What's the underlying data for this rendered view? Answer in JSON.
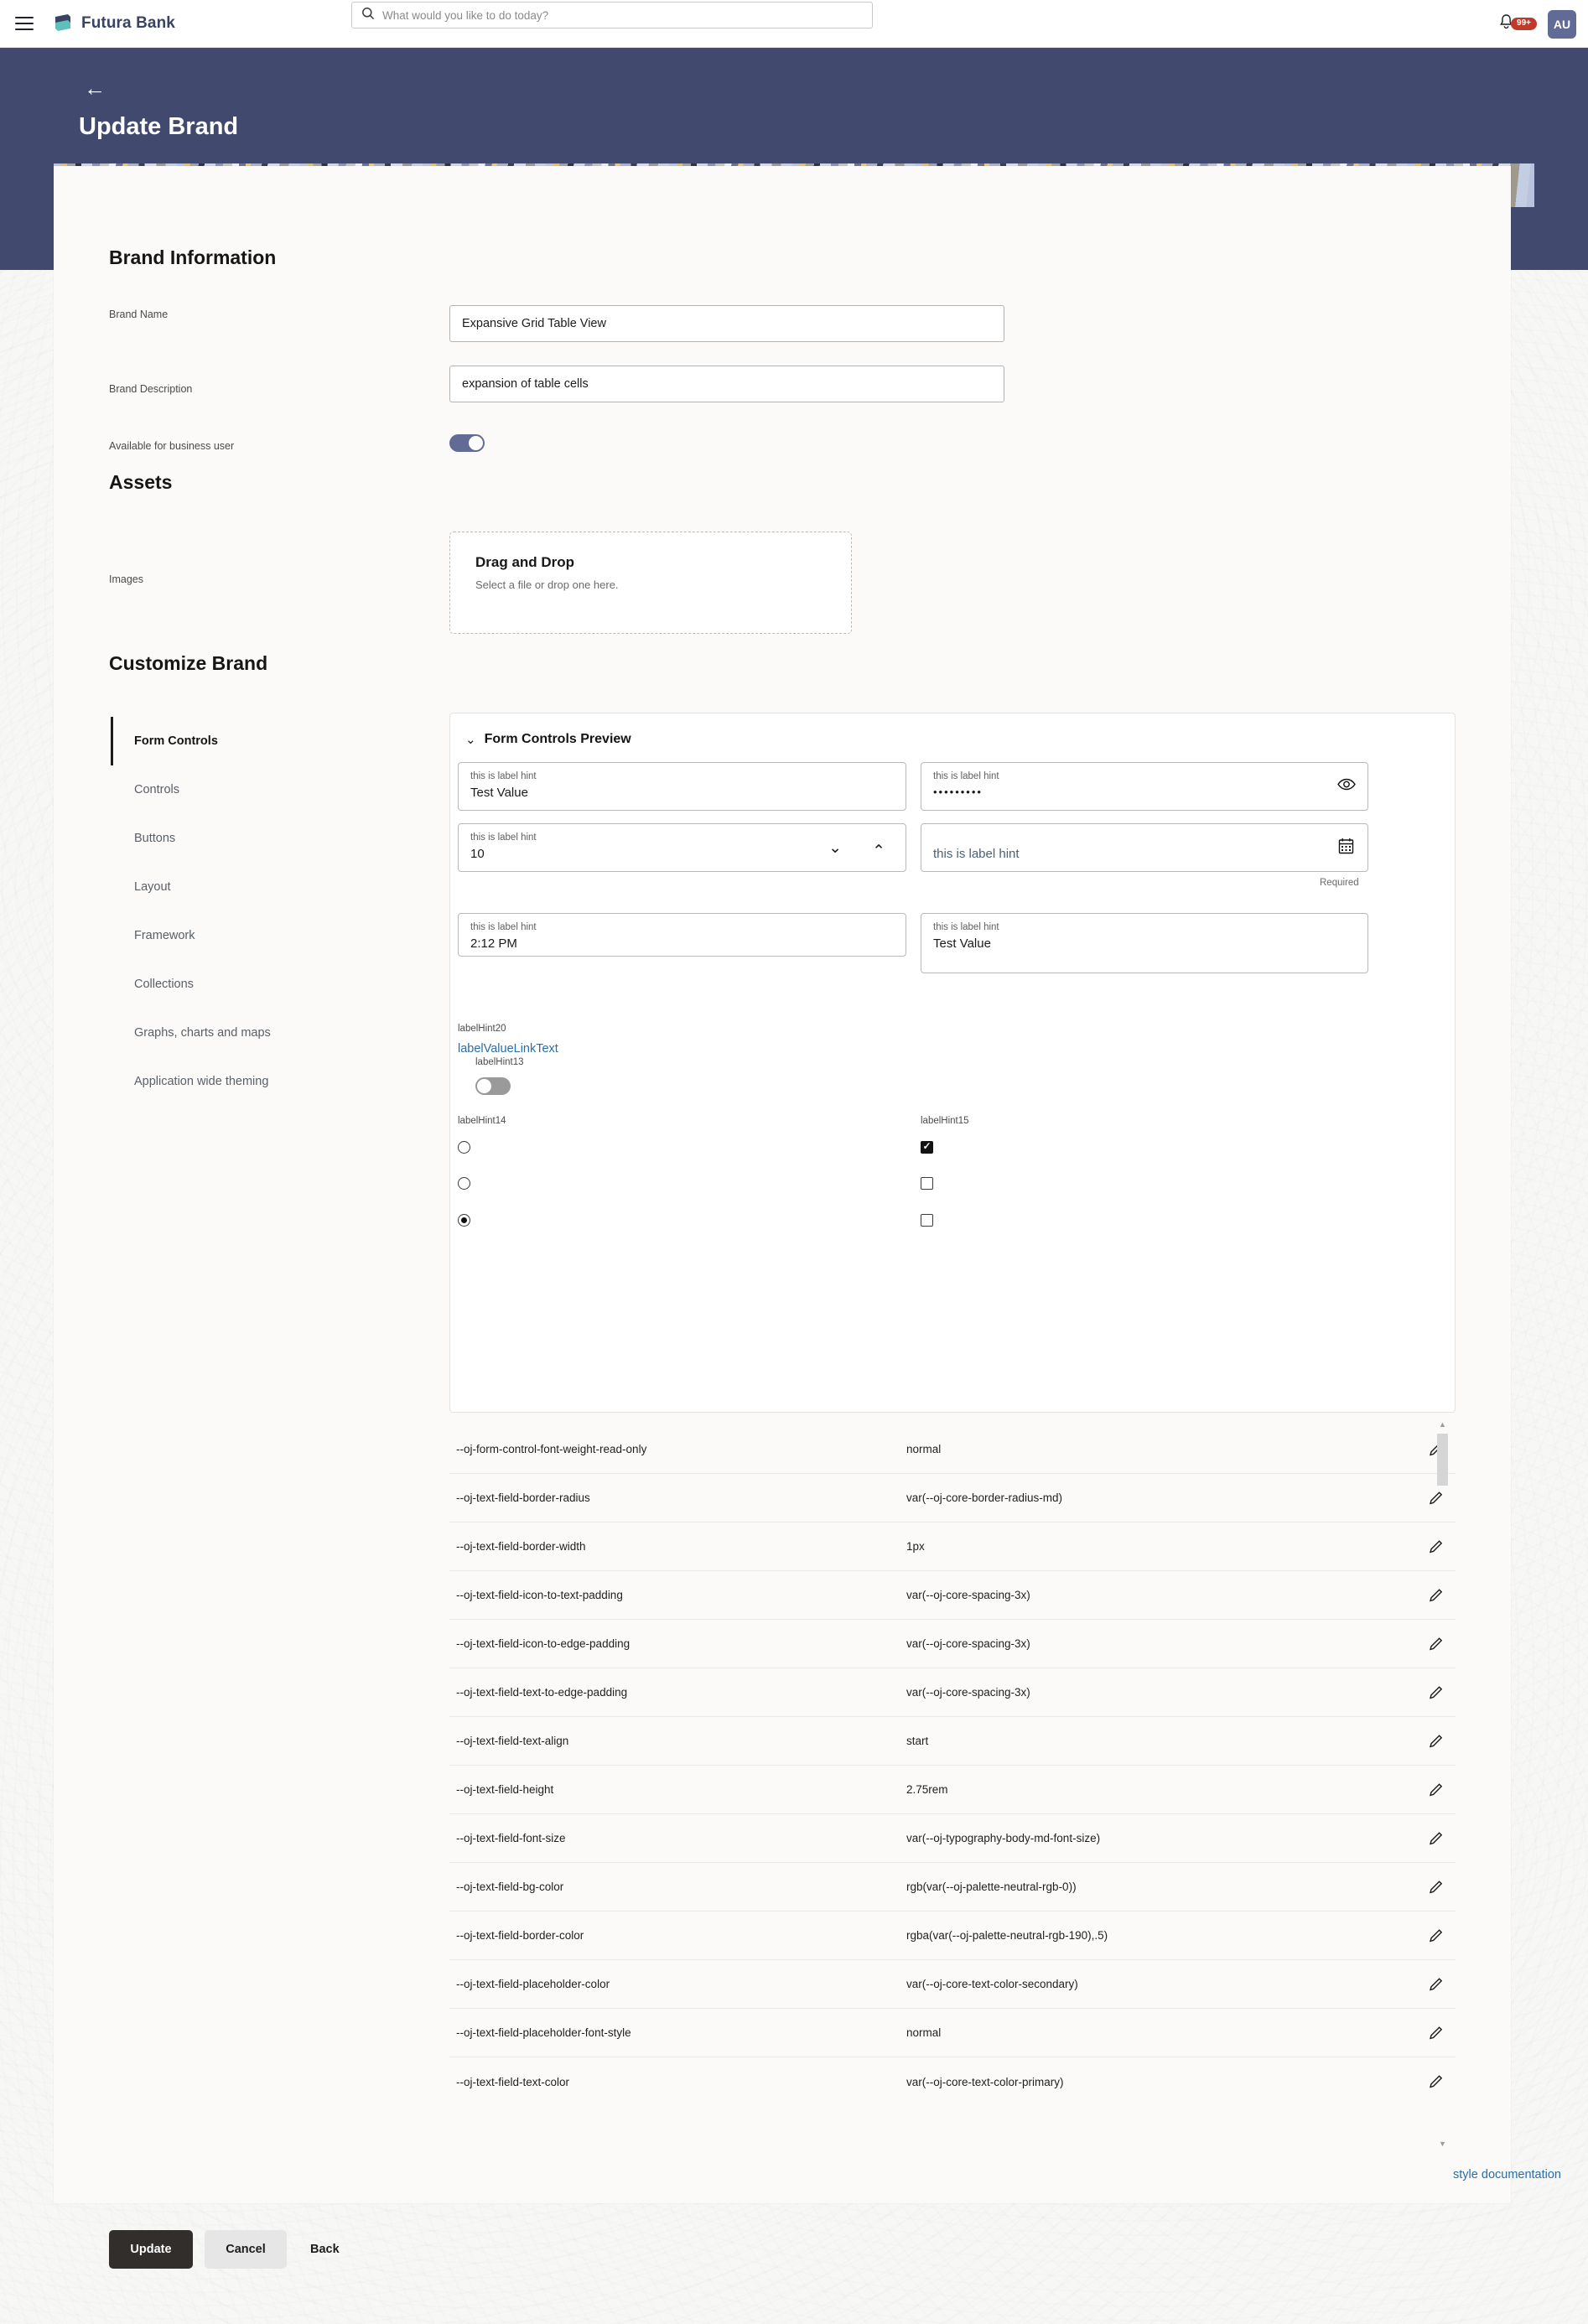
{
  "topbar": {
    "menu_icon": "hamburger-icon",
    "brand_name": "Futura Bank",
    "search_placeholder": "What would you like to do today?",
    "search_value": "",
    "notification_count": "99+",
    "avatar_initials": "AU"
  },
  "hero": {
    "back_icon": "back-arrow-icon",
    "title": "Update Brand"
  },
  "brand_information": {
    "section_title": "Brand Information",
    "brand_name_label": "Brand Name",
    "brand_name_value": "Expansive Grid Table View",
    "brand_description_label": "Brand Description",
    "brand_description_value": "expansion of table cells",
    "available_label": "Available for business user",
    "available_state": "on"
  },
  "assets": {
    "section_title": "Assets",
    "images_label": "Images",
    "dropzone_title": "Drag and Drop",
    "dropzone_subtitle": "Select a file or drop one here."
  },
  "customize_brand": {
    "section_title": "Customize Brand",
    "nav_items": [
      {
        "label": "Form Controls",
        "active": true
      },
      {
        "label": "Controls",
        "active": false
      },
      {
        "label": "Buttons",
        "active": false
      },
      {
        "label": "Layout",
        "active": false
      },
      {
        "label": "Framework",
        "active": false
      },
      {
        "label": "Collections",
        "active": false
      },
      {
        "label": "Graphs, charts and maps",
        "active": false
      },
      {
        "label": "Application wide theming",
        "active": false
      }
    ]
  },
  "preview": {
    "title": "Form Controls Preview",
    "collapse_icon": "chevron-down-icon",
    "text_field": {
      "hint": "this is label hint",
      "value": "Test Value"
    },
    "password_field": {
      "hint": "this is label hint",
      "value": "•••••••••",
      "icon": "eye-icon"
    },
    "number_field": {
      "hint": "this is label hint",
      "value": "10",
      "down_icon": "chevron-down-icon",
      "up_icon": "chevron-up-icon"
    },
    "date_field": {
      "hint": "this is label hint",
      "value": "",
      "icon": "calendar-icon",
      "helper": "Required"
    },
    "time_field": {
      "hint": "this is label hint",
      "value": "2:12 PM"
    },
    "textarea_field": {
      "hint": "this is label hint",
      "value": "Test Value"
    },
    "link_group": {
      "label": "labelHint20",
      "link_text": "labelValueLinkText"
    },
    "switch_group": {
      "label": "labelHint13",
      "state": "off"
    },
    "radio_group": {
      "label": "labelHint14",
      "selected_index": 2,
      "count": 3
    },
    "checkbox_group": {
      "label": "labelHint15",
      "checked": [
        true,
        false,
        false
      ]
    }
  },
  "tokens": {
    "columns": [
      "name",
      "value"
    ],
    "rows": [
      {
        "name": "--oj-form-control-font-weight-read-only",
        "value": "normal"
      },
      {
        "name": "--oj-text-field-border-radius",
        "value": "var(--oj-core-border-radius-md)"
      },
      {
        "name": "--oj-text-field-border-width",
        "value": "1px"
      },
      {
        "name": "--oj-text-field-icon-to-text-padding",
        "value": "var(--oj-core-spacing-3x)"
      },
      {
        "name": "--oj-text-field-icon-to-edge-padding",
        "value": "var(--oj-core-spacing-3x)"
      },
      {
        "name": "--oj-text-field-text-to-edge-padding",
        "value": "var(--oj-core-spacing-3x)"
      },
      {
        "name": "--oj-text-field-text-align",
        "value": "start"
      },
      {
        "name": "--oj-text-field-height",
        "value": "2.75rem"
      },
      {
        "name": "--oj-text-field-font-size",
        "value": "var(--oj-typography-body-md-font-size)"
      },
      {
        "name": "--oj-text-field-bg-color",
        "value": "rgb(var(--oj-palette-neutral-rgb-0))"
      },
      {
        "name": "--oj-text-field-border-color",
        "value": "rgba(var(--oj-palette-neutral-rgb-190),.5)"
      },
      {
        "name": "--oj-text-field-placeholder-color",
        "value": "var(--oj-core-text-color-secondary)"
      },
      {
        "name": "--oj-text-field-placeholder-font-style",
        "value": "normal"
      },
      {
        "name": "--oj-text-field-text-color",
        "value": "var(--oj-core-text-color-primary)"
      }
    ],
    "edit_icon": "pencil-icon",
    "style_documentation_link": "style documentation"
  },
  "footer": {
    "update_label": "Update",
    "cancel_label": "Cancel",
    "back_label": "Back"
  },
  "colors": {
    "hero_bg": "#414a6e",
    "accent_toggle": "#616b95",
    "link": "#2a6ea8",
    "badge": "#c0392b",
    "primary_button": "#312e2b"
  }
}
